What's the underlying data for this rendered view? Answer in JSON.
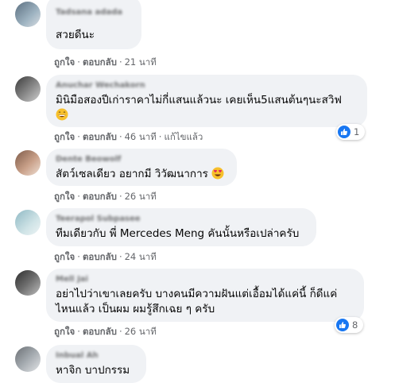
{
  "comments": [
    {
      "author": "Tadsana adada",
      "text": "สวยดีนะ",
      "like": "ถูกใจ",
      "reply": "ตอบกลับ",
      "time": "21 นาที"
    },
    {
      "author": "Anuchar Wechakorn",
      "text": "มินิมือสองปีเก่าราคาไม่กี่แสนแล้วนะ เคยเห็น5แสนต้นๆนะสวิฟ",
      "emoji": "grinning-face-emoji",
      "like": "ถูกใจ",
      "reply": "ตอบกลับ",
      "time": "46 นาที",
      "edited": "แก้ไขแล้ว",
      "reaction_count": "1"
    },
    {
      "author": "Dente Beowolf",
      "text": "สัตว์เซลเดียว อยากมี วิวัฒนาการ",
      "emoji": "heart-eyes-emoji",
      "like": "ถูกใจ",
      "reply": "ตอบกลับ",
      "time": "26 นาที"
    },
    {
      "author": "Teerapol Subpasee",
      "text": "ทีมเดียวกับ พี่ Mercedes Meng คันนั้นหรือเปล่าครับ",
      "like": "ถูกใจ",
      "reply": "ตอบกลับ",
      "time": "24 นาที"
    },
    {
      "author": "Mell Jai",
      "text": "อย่าไปว่าเขาเลยครับ บางคนมีความฝันแต่เอื้อมได้แค่นี้ ก็ดีแค่ไหนแล้ว เป็นผม ผมรู้สึกเฉย ๆ ครับ",
      "like": "ถูกใจ",
      "reply": "ตอบกลับ",
      "time": "26 นาที",
      "reaction_count": "8"
    },
    {
      "author": "Inbual Ah",
      "text": "หาจิก บาปกรรม"
    }
  ],
  "colors": {
    "bubble": "#f0f2f5",
    "meta": "#65676b",
    "like_blue": "#1877f2"
  }
}
